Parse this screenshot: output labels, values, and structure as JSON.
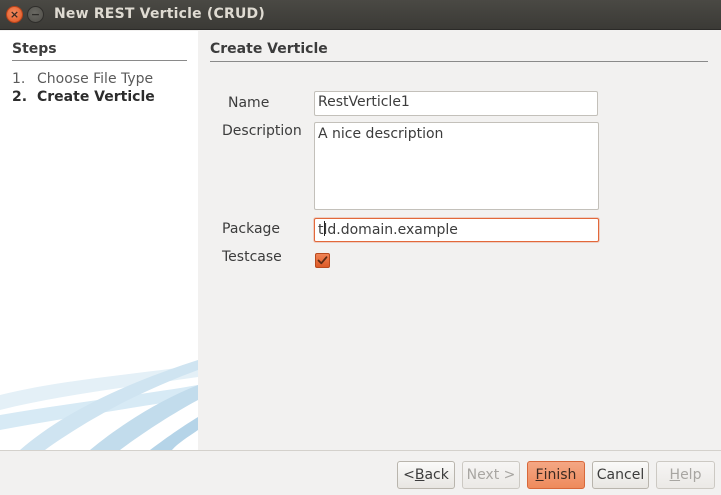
{
  "window": {
    "title": "New REST Verticle (CRUD)",
    "close_glyph": "×",
    "minimize_glyph": "−"
  },
  "steps": {
    "heading": "Steps",
    "items": [
      {
        "number": "1.",
        "label": "Choose File Type",
        "current": false
      },
      {
        "number": "2.",
        "label": "Create Verticle",
        "current": true
      }
    ]
  },
  "form": {
    "heading": "Create Verticle",
    "name": {
      "label": "Name",
      "value": "RestVerticle1"
    },
    "description": {
      "label": "Description",
      "value": "A nice description"
    },
    "package": {
      "label": "Package",
      "value_before_caret": "t",
      "value_after_caret": "ld.domain.example"
    },
    "testcase": {
      "label": "Testcase",
      "checked": true
    }
  },
  "buttons": {
    "back": {
      "before": "< ",
      "mnemonic": "B",
      "after": "ack"
    },
    "next": {
      "label": "Next >"
    },
    "finish": {
      "mnemonic": "F",
      "after": "inish"
    },
    "cancel": {
      "label": "Cancel"
    },
    "help": {
      "mnemonic": "H",
      "after": "elp"
    }
  },
  "colors": {
    "accent": "#e2683a",
    "titlebar": "#3b3a36",
    "panel": "#ffffff",
    "background": "#f2f1f0"
  }
}
